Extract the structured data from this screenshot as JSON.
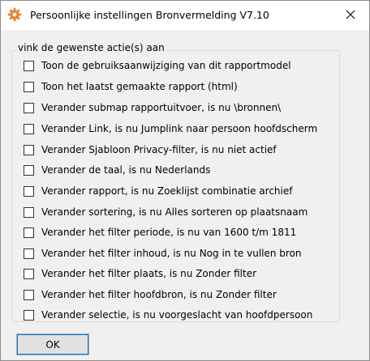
{
  "window": {
    "title": "Persoonlijke instellingen Bronvermelding V7.10",
    "app_icon": "gear-icon",
    "close_icon": "close-icon"
  },
  "group": {
    "label": "vink de gewenste actie(s) aan"
  },
  "options": [
    {
      "label": "Toon de gebruiksaanwijziging van dit rapportmodel",
      "checked": false
    },
    {
      "label": "Toon het laatst gemaakte rapport (html)",
      "checked": false
    },
    {
      "label": "Verander submap rapportuitvoer, is nu \\bronnen\\",
      "checked": false
    },
    {
      "label": "Verander Link, is nu Jumplink naar persoon hoofdscherm",
      "checked": false
    },
    {
      "label": "Verander Sjabloon Privacy-filter, is nu niet actief",
      "checked": false
    },
    {
      "label": "Verander de taal, is nu Nederlands",
      "checked": false
    },
    {
      "label": "Verander rapport, is nu Zoeklijst combinatie archief",
      "checked": false
    },
    {
      "label": "Verander sortering, is nu Alles sorteren op plaatsnaam",
      "checked": false
    },
    {
      "label": "Verander het filter periode, is nu van 1600 t/m 1811",
      "checked": false
    },
    {
      "label": "Verander het filter inhoud, is nu Nog in te vullen bron",
      "checked": false
    },
    {
      "label": "Verander het filter plaats, is nu Zonder filter",
      "checked": false
    },
    {
      "label": "Verander het filter hoofdbron, is nu Zonder filter",
      "checked": false
    },
    {
      "label": "Verander selectie, is nu voorgeslacht van hoofdpersoon",
      "checked": false
    }
  ],
  "buttons": {
    "ok_label": "OK"
  },
  "colors": {
    "window_bg": "#f0f0f0",
    "titlebar_bg": "#ffffff",
    "focus_outline": "#0078d7",
    "gear_orange": "#e8832a"
  }
}
